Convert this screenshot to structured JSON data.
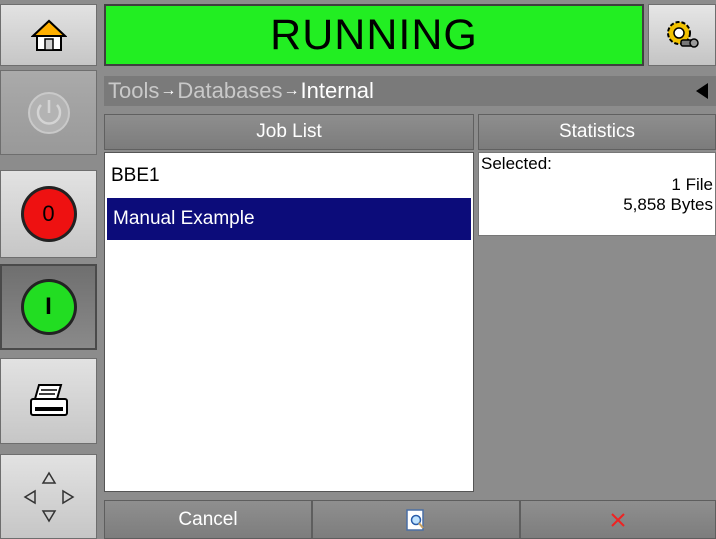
{
  "status": {
    "text": "RUNNING",
    "color": "#22ee22"
  },
  "breadcrumb": {
    "items": [
      "Tools",
      "Databases",
      "Internal"
    ],
    "separator": "→"
  },
  "sidebar": {
    "icons": [
      "home-icon",
      "power-icon",
      "stop-icon",
      "start-icon",
      "print-icon",
      "navigate-icon"
    ],
    "stop_label": "0",
    "start_label": "I"
  },
  "job_list": {
    "header": "Job List",
    "items": [
      "BBE1",
      "Manual Example"
    ],
    "selected_index": 1
  },
  "statistics": {
    "header": "Statistics",
    "selected_label": "Selected:",
    "files": "1 File",
    "bytes": "5,858 Bytes"
  },
  "bottom": {
    "cancel_label": "Cancel",
    "preview_icon": "preview-icon",
    "delete_icon": "delete-icon"
  },
  "colors": {
    "selection": "#0c0c7a",
    "stop": "#ee1111",
    "start": "#22dd22"
  }
}
